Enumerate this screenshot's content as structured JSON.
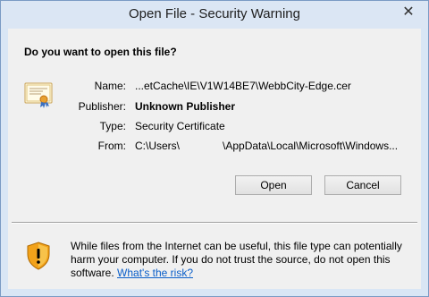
{
  "window": {
    "title": "Open File - Security Warning",
    "close_glyph": "✕"
  },
  "dialog": {
    "question": "Do you want to open this file?",
    "fields": {
      "name_label": "Name:",
      "name_value": "...etCache\\IE\\V1W14BE7\\WebbCity-Edge.cer",
      "publisher_label": "Publisher:",
      "publisher_value": "Unknown Publisher",
      "type_label": "Type:",
      "type_value": "Security Certificate",
      "from_label": "From:",
      "from_value_start": "C:\\Users\\",
      "from_value_end": "\\AppData\\Local\\Microsoft\\Windows..."
    },
    "buttons": {
      "open": "Open",
      "cancel": "Cancel"
    },
    "warning": {
      "text": "While files from the Internet can be useful, this file type can potentially harm your computer. If you do not trust the source, do not open this software. ",
      "link": "What's the risk?"
    }
  },
  "icons": {
    "certificate": "certificate-icon",
    "shield": "warning-shield-icon",
    "close": "close-icon"
  },
  "colors": {
    "title_bar": "#dbe6f4",
    "client_bg": "#f0f0f0",
    "link": "#0a5ec9",
    "shield_orange": "#f2a21a"
  }
}
